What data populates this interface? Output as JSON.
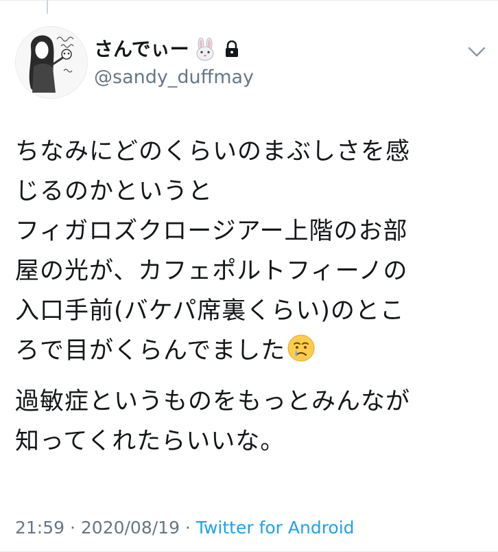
{
  "tweet": {
    "author": {
      "display_name": "さんでぃー",
      "name_emoji": "rabbit-face-icon",
      "protected_icon": "lock-icon",
      "handle": "@sandy_duffmay",
      "avatar": "avatar-illustration"
    },
    "menu_icon": "chevron-down-icon",
    "body": {
      "paragraph1": {
        "line1": "ちなみにどのくらいのまぶしさを感",
        "line2": "じるのかというと",
        "line3": "フィガロズクロージアー上階のお部",
        "line4": "屋の光が、カフェポルトフィーノの",
        "line5": "入口手前(バケパ席裏くらい)のとこ",
        "line6": "ろで目がくらんでました",
        "line6_emoji": "crying-face-icon"
      },
      "paragraph2": {
        "line1": "過敏症というものをもっとみんなが",
        "line2": "知ってくれたらいいな。"
      }
    },
    "meta": {
      "time": "21:59",
      "separator1": " · ",
      "date": "2020/08/19",
      "separator2": " · ",
      "source": "Twitter for Android"
    },
    "colors": {
      "text": "#14171a",
      "secondary": "#657786",
      "link": "#1da1f2",
      "divider": "#e6ecf0"
    }
  }
}
